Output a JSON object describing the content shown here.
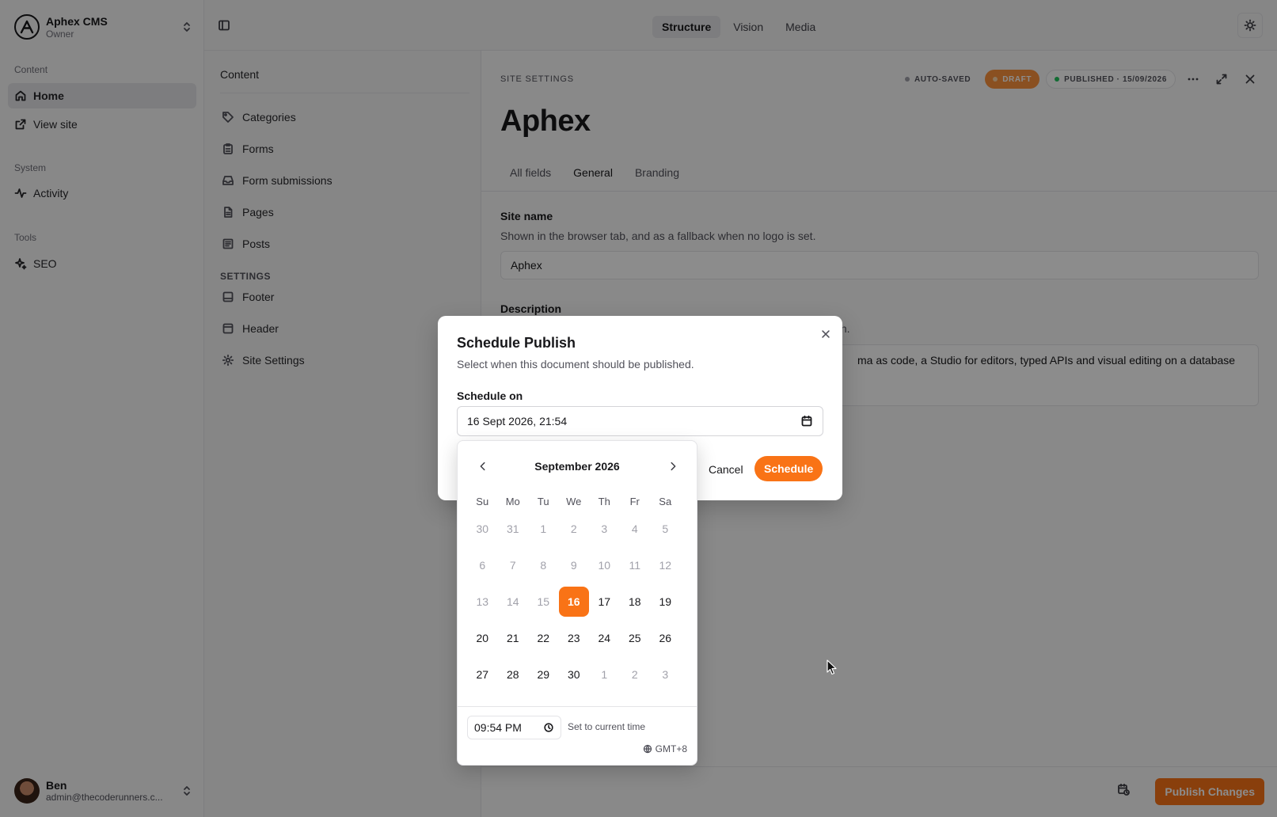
{
  "brand": {
    "name": "Aphex CMS",
    "role": "Owner"
  },
  "sidebar": {
    "groups": {
      "content": "Content",
      "system": "System",
      "tools": "Tools"
    },
    "items": [
      {
        "label": "Home",
        "icon": "home-icon"
      },
      {
        "label": "View site",
        "icon": "external-link-icon"
      },
      {
        "label": "Activity",
        "icon": "activity-icon"
      },
      {
        "label": "SEO",
        "icon": "sparkles-icon"
      }
    ],
    "user": {
      "name": "Ben",
      "email": "admin@thecoderunners.c..."
    }
  },
  "topbar": {
    "tabs": [
      "Structure",
      "Vision",
      "Media"
    ]
  },
  "content_panel": {
    "title": "Content",
    "items": [
      "Categories",
      "Forms",
      "Form submissions",
      "Pages",
      "Posts"
    ],
    "settings_label": "SETTINGS",
    "settings_items": [
      "Footer",
      "Header",
      "Site Settings"
    ]
  },
  "document": {
    "kicker": "SITE SETTINGS",
    "status": {
      "autosaved": "AUTO-SAVED",
      "draft": "DRAFT",
      "published": "PUBLISHED · 15/09/2026"
    },
    "title": "Aphex",
    "tabs": [
      "All fields",
      "General",
      "Branding"
    ],
    "site_name": {
      "label": "Site name",
      "help": "Shown in the browser tab, and as a fallback when no logo is set.",
      "value": "Aphex"
    },
    "description": {
      "label": "Description",
      "help_visible": "own.",
      "value_visible": "ma as code, a Studio for editors, typed APIs and visual editing on a database"
    },
    "publish_label": "Publish Changes"
  },
  "dialog": {
    "title": "Schedule Publish",
    "description": "Select when this document should be published.",
    "field_label": "Schedule on",
    "value": "16 Sept 2026, 21:54",
    "cancel": "Cancel",
    "schedule": "Schedule"
  },
  "calendar": {
    "month": "September 2026",
    "weekdays": [
      "Su",
      "Mo",
      "Tu",
      "We",
      "Th",
      "Fr",
      "Sa"
    ],
    "weeks": [
      [
        "30",
        "31",
        "1",
        "2",
        "3",
        "4",
        "5"
      ],
      [
        "6",
        "7",
        "8",
        "9",
        "10",
        "11",
        "12"
      ],
      [
        "13",
        "14",
        "15",
        "16",
        "17",
        "18",
        "19"
      ],
      [
        "20",
        "21",
        "22",
        "23",
        "24",
        "25",
        "26"
      ],
      [
        "27",
        "28",
        "29",
        "30",
        "1",
        "2",
        "3"
      ]
    ],
    "selected": "16",
    "time": "09:54 PM",
    "set_now": "Set to current time",
    "timezone": "GMT+8"
  },
  "colors": {
    "accent": "#f97316",
    "draft_pill": "#fb923c",
    "published_dot": "#22c55e",
    "autosaved_dot": "#a1a1aa"
  }
}
